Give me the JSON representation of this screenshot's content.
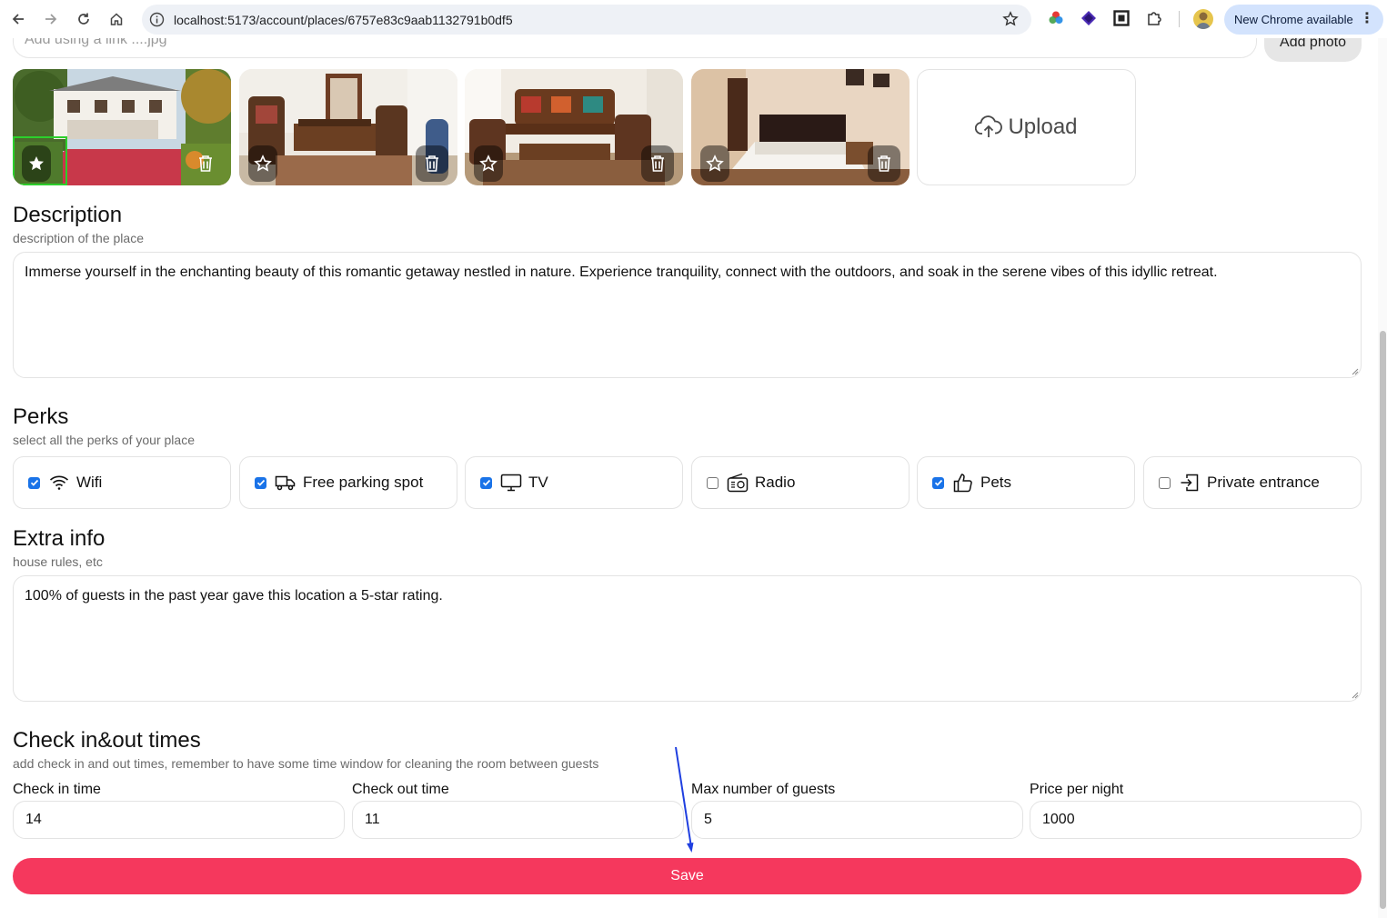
{
  "browser": {
    "url": "localhost:5173/account/places/6757e83c9aab1132791b0df5",
    "update_label": "New Chrome available"
  },
  "photos_section": {
    "link_placeholder": "Add using a link ....jpg",
    "add_photo_label": "Add photo",
    "upload_label": "Upload",
    "photos": [
      {
        "name": "house-exterior",
        "is_main": true
      },
      {
        "name": "living-room-1",
        "is_main": false
      },
      {
        "name": "living-room-2",
        "is_main": false
      },
      {
        "name": "bedroom",
        "is_main": false
      }
    ]
  },
  "description": {
    "title": "Description",
    "subtitle": "description of the place",
    "value": "Immerse yourself in the enchanting beauty of this romantic getaway nestled in nature. Experience tranquility, connect with the outdoors, and soak in the serene vibes of this idyllic retreat."
  },
  "perks": {
    "title": "Perks",
    "subtitle": "select all the perks of your place",
    "items": [
      {
        "label": "Wifi",
        "checked": true,
        "icon": "wifi-icon"
      },
      {
        "label": "Free parking spot",
        "checked": true,
        "icon": "truck-icon"
      },
      {
        "label": "TV",
        "checked": true,
        "icon": "monitor-icon"
      },
      {
        "label": "Radio",
        "checked": false,
        "icon": "radio-icon"
      },
      {
        "label": "Pets",
        "checked": true,
        "icon": "thumbs-up-icon"
      },
      {
        "label": "Private entrance",
        "checked": false,
        "icon": "door-enter-icon"
      }
    ]
  },
  "extra_info": {
    "title": "Extra info",
    "subtitle": "house rules, etc",
    "value": "100% of guests in the past year gave this location a 5-star rating."
  },
  "times": {
    "title": "Check in&out times",
    "subtitle": "add check in and out times, remember to have some time window for cleaning the room between guests",
    "fields": [
      {
        "label": "Check in time",
        "value": "14"
      },
      {
        "label": "Check out time",
        "value": "11"
      },
      {
        "label": "Max number of guests",
        "value": "5"
      },
      {
        "label": "Price per night",
        "value": "1000"
      }
    ]
  },
  "save_label": "Save",
  "colors": {
    "accent": "#f5385d",
    "checkbox": "#1a73e8",
    "main_photo_border": "#2ccf2c"
  }
}
